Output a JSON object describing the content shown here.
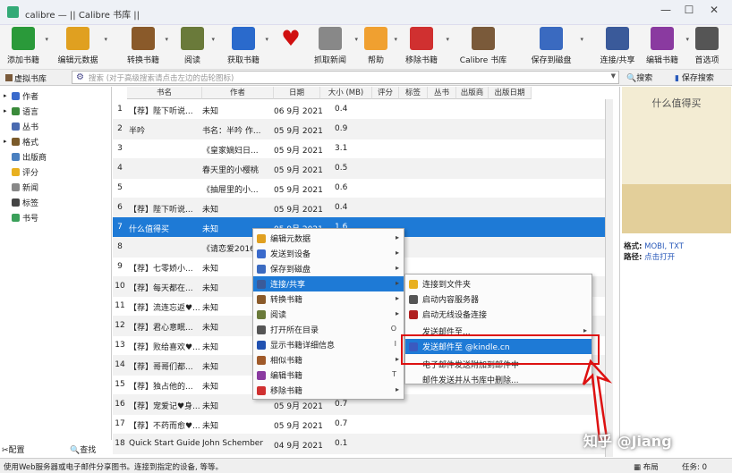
{
  "window": {
    "title": "calibre — || Calibre 书库 ||",
    "minimize": "—",
    "maximize": "☐",
    "close": "✕"
  },
  "toolbar": [
    {
      "label": "添加书籍",
      "icon": "add-book-icon",
      "color": "#2a9a3a"
    },
    {
      "label": "编辑元数据",
      "icon": "edit-metadata-icon",
      "color": "#e0a020"
    },
    {
      "label": "转换书籍",
      "icon": "convert-books-icon",
      "color": "#8a5a2a"
    },
    {
      "label": "阅读",
      "icon": "read-icon",
      "color": "#6a7a3a"
    },
    {
      "label": "获取书籍",
      "icon": "get-books-icon",
      "color": "#2a6acc"
    },
    {
      "label": "",
      "icon": "heart-icon",
      "color": "#d01010"
    },
    {
      "label": "抓取新闻",
      "icon": "fetch-news-icon",
      "color": "#888888"
    },
    {
      "label": "帮助",
      "icon": "help-icon",
      "color": "#f0a030"
    },
    {
      "label": "移除书籍",
      "icon": "remove-books-icon",
      "color": "#d03030"
    },
    {
      "label": "Calibre 书库",
      "icon": "library-icon",
      "color": "#7a5a3a"
    },
    {
      "label": "保存到磁盘",
      "icon": "save-to-disk-icon",
      "color": "#3a6ac0"
    },
    {
      "label": "连接/共享",
      "icon": "connect-share-icon",
      "color": "#3a5a9a"
    },
    {
      "label": "编辑书籍",
      "icon": "edit-book-icon",
      "color": "#8a3aa0"
    },
    {
      "label": "首选项",
      "icon": "preferences-icon",
      "color": "#555555"
    }
  ],
  "searchbar": {
    "virtual_library": "虚拟书库",
    "placeholder": "搜索 (对于高级搜索请点击左边的齿轮图标)",
    "search_label": "搜索",
    "save_search_label": "保存搜索"
  },
  "sidebar": [
    {
      "label": "作者",
      "icon": "person-icon",
      "color": "#3a6acc",
      "expand": "▸"
    },
    {
      "label": "语言",
      "icon": "language-icon",
      "color": "#3a8a3a",
      "expand": "▸"
    },
    {
      "label": "丛书",
      "icon": "series-icon",
      "color": "#4a6ab0",
      "expand": ""
    },
    {
      "label": "格式",
      "icon": "format-icon",
      "color": "#7a5a2a",
      "expand": "▸"
    },
    {
      "label": "出版商",
      "icon": "publisher-icon",
      "color": "#4a80c0",
      "expand": ""
    },
    {
      "label": "评分",
      "icon": "star-icon",
      "color": "#e8b020",
      "expand": ""
    },
    {
      "label": "新闻",
      "icon": "news-icon",
      "color": "#888888",
      "expand": ""
    },
    {
      "label": "标签",
      "icon": "tag-icon",
      "color": "#444444",
      "expand": ""
    },
    {
      "label": "书号",
      "icon": "isbn-icon",
      "color": "#3aa05a",
      "expand": ""
    }
  ],
  "sidebar_bottom": {
    "configure": "配置",
    "find": "查找"
  },
  "table": {
    "headers": [
      "书名",
      "作者",
      "日期",
      "大小 (MB)",
      "评分",
      "标签",
      "丛书",
      "出版商",
      "出版日期"
    ],
    "rows": [
      {
        "num": "1",
        "title": "【荐】陛下听说...",
        "author": "未知",
        "date": "06 9月 2021",
        "size": "0.4"
      },
      {
        "num": "2",
        "title": "半吟",
        "author": "书名：半吟 作...",
        "date": "05 9月 2021",
        "size": "0.9"
      },
      {
        "num": "3",
        "title": "",
        "author": "《皇家嫡妇日...",
        "date": "05 9月 2021",
        "size": "3.1"
      },
      {
        "num": "4",
        "title": "",
        "author": "春天里的小樱桃",
        "date": "05 9月 2021",
        "size": "0.5"
      },
      {
        "num": "5",
        "title": "",
        "author": "《抽屉里的小...",
        "date": "05 9月 2021",
        "size": "0.6"
      },
      {
        "num": "6",
        "title": "【荐】陛下听说...",
        "author": "未知",
        "date": "05 9月 2021",
        "size": "0.4"
      },
      {
        "num": "7",
        "title": "什么值得买",
        "author": "未知",
        "date": "05 9月 2021",
        "size": "1.6"
      },
      {
        "num": "8",
        "title": "",
        "author": "《请恋爱2016...",
        "date": "",
        "size": ""
      },
      {
        "num": "9",
        "title": "【荐】七零娇小...",
        "author": "未知",
        "date": "",
        "size": ""
      },
      {
        "num": "10",
        "title": "【荐】每天都在...",
        "author": "未知",
        "date": "",
        "size": ""
      },
      {
        "num": "11",
        "title": "【荐】流连忘返♥...",
        "author": "未知",
        "date": "",
        "size": ""
      },
      {
        "num": "12",
        "title": "【荐】君心意眠...",
        "author": "未知",
        "date": "",
        "size": ""
      },
      {
        "num": "13",
        "title": "【荐】败给喜欢♥...",
        "author": "未知",
        "date": "",
        "size": ""
      },
      {
        "num": "14",
        "title": "【荐】哥哥们都...",
        "author": "未知",
        "date": "",
        "size": ""
      },
      {
        "num": "15",
        "title": "【荐】独占他的...",
        "author": "未知",
        "date": "",
        "size": ""
      },
      {
        "num": "16",
        "title": "【荐】宠爱记♥身...",
        "author": "未知",
        "date": "05 9月 2021",
        "size": "0.7"
      },
      {
        "num": "17",
        "title": "【荐】不药而愈♥...",
        "author": "未知",
        "date": "05 9月 2021",
        "size": "0.7"
      },
      {
        "num": "18",
        "title": "Quick Start Guide",
        "author": "John Schember",
        "date": "04 9月 2021",
        "size": "0.1"
      }
    ]
  },
  "details": {
    "cover_text": "什么值得买",
    "format_label": "格式:",
    "format_value": "MOBI, TXT",
    "path_label": "路径:",
    "path_value": "点击打开"
  },
  "context_menu": [
    {
      "label": "编辑元数据",
      "icon": "edit-metadata-icon",
      "color": "#e0a020",
      "submenu": true,
      "shortcut": ""
    },
    {
      "label": "发送到设备",
      "icon": "send-device-icon",
      "color": "#3a6acc",
      "submenu": true,
      "shortcut": ""
    },
    {
      "label": "保存到磁盘",
      "icon": "save-to-disk-icon",
      "color": "#3a6ac0",
      "submenu": true,
      "shortcut": ""
    },
    {
      "label": "连接/共享",
      "icon": "connect-share-icon",
      "color": "#3a5a9a",
      "submenu": true,
      "shortcut": "",
      "highlight": true
    },
    {
      "label": "转换书籍",
      "icon": "convert-books-icon",
      "color": "#8a5a2a",
      "submenu": true,
      "shortcut": ""
    },
    {
      "label": "阅读",
      "icon": "read-icon",
      "color": "#6a7a3a",
      "submenu": true,
      "shortcut": ""
    },
    {
      "label": "打开所在目录",
      "icon": "folder-icon",
      "color": "#555555",
      "submenu": false,
      "shortcut": "O"
    },
    {
      "label": "显示书籍详细信息",
      "icon": "info-icon",
      "color": "#2050b0",
      "submenu": false,
      "shortcut": "I"
    },
    {
      "label": "相似书籍",
      "icon": "similar-books-icon",
      "color": "#a05a2a",
      "submenu": true,
      "shortcut": ""
    },
    {
      "label": "编辑书籍",
      "icon": "edit-book-icon",
      "color": "#8a3aa0",
      "submenu": false,
      "shortcut": "T"
    },
    {
      "label": "移除书籍",
      "icon": "remove-books-icon",
      "color": "#d03030",
      "submenu": true,
      "shortcut": ""
    }
  ],
  "submenu": [
    {
      "label": "连接到文件夹",
      "icon": "folder-icon",
      "color": "#e8b020"
    },
    {
      "label": "启动内容服务器",
      "icon": "server-icon",
      "color": "#555555"
    },
    {
      "label": "启动无线设备连接",
      "icon": "wireless-icon",
      "color": "#b02020"
    },
    {
      "label": "发送邮件至...",
      "icon": "",
      "color": "",
      "submenu": true
    },
    {
      "label": "发送邮件至 @kindle.cn",
      "icon": "email-icon",
      "color": "#3a5ac0",
      "highlight": true
    },
    {
      "label": "电子邮件发送附加到邮件中",
      "icon": "",
      "color": ""
    },
    {
      "label": "邮件发送并从书库中删除...",
      "icon": "",
      "color": ""
    }
  ],
  "statusbar": {
    "text": "使用Web服务器或电子邮件分享图书。连接到指定的设备, 等等。",
    "layout": "布局",
    "jobs": "任务: 0"
  },
  "watermark": "知乎 @Jiang"
}
